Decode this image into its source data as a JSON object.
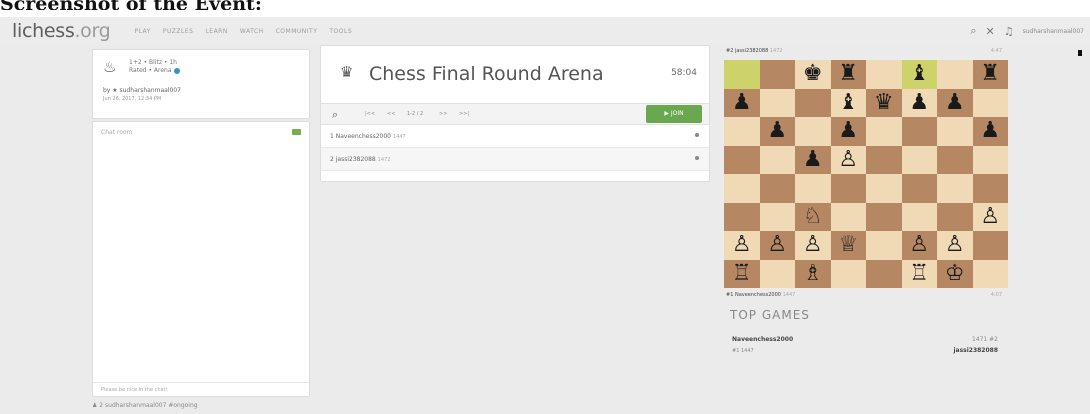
{
  "caption": "Screenshot of the Event:",
  "header": {
    "logo_main": "lichess",
    "logo_tld": ".org",
    "nav": [
      "PLAY",
      "PUZZLES",
      "LEARN",
      "WATCH",
      "COMMUNITY",
      "TOOLS"
    ],
    "username": "sudharshanmaal007"
  },
  "tournament_info": {
    "line1": "1+2 • Blitz • 1h",
    "line2": "Rated • Arena",
    "creator": "by ★ sudharshanmaal007",
    "date": "Jun 26, 2017, 12:34 PM"
  },
  "chat": {
    "placeholder": "Chat room",
    "footer": "Please be nice in the chat!"
  },
  "bottom_note": "♟ 2 sudharshanmaal007 #ongoing",
  "main": {
    "title": "Chess Final Round Arena",
    "clock": "58:04",
    "pager": {
      "first": "|<<",
      "prev": "<<",
      "range": "1-2 / 2",
      "next": ">>",
      "last": ">>|"
    },
    "join_label": "▶ JOIN",
    "players": [
      {
        "rank": "1",
        "name": "Naveenchess2000",
        "rating": "1447"
      },
      {
        "rank": "2",
        "name": "jassi2382088",
        "rating": "1472"
      }
    ]
  },
  "board": {
    "top_label": "#2 jassi2382088",
    "top_rating": "1472",
    "top_right": "4:47",
    "bottom_label": "#1 Naveenchess2000",
    "bottom_rating": "1447",
    "bottom_right": "4:07",
    "position": [
      [
        "",
        "",
        "♚",
        "♜",
        "",
        "♝",
        "",
        "♜"
      ],
      [
        "♟",
        "",
        "",
        "♝",
        "♛",
        "♟",
        "♟",
        ""
      ],
      [
        "",
        "♟",
        "",
        "♟",
        "",
        "",
        "",
        "♟"
      ],
      [
        "",
        "",
        "♟",
        "♙",
        "",
        "",
        "",
        ""
      ],
      [
        "",
        "",
        "",
        "",
        "",
        "",
        "",
        ""
      ],
      [
        "",
        "",
        "♘",
        "",
        "",
        "",
        "",
        "♙"
      ],
      [
        "♙",
        "♙",
        "♙",
        "♕",
        "",
        "♙",
        "♙",
        ""
      ],
      [
        "♖",
        "",
        "♗",
        "",
        "",
        "♖",
        "♔",
        ""
      ]
    ],
    "highlight": [
      [
        0,
        0
      ],
      [
        0,
        5
      ]
    ]
  },
  "top_games": {
    "title": "TOP GAMES",
    "player1": "Naveenchess2000",
    "rating1": "1447",
    "rank1": "#1",
    "rating1_short": "1447",
    "result": "1471 #2",
    "player2": "jassi2382088"
  }
}
